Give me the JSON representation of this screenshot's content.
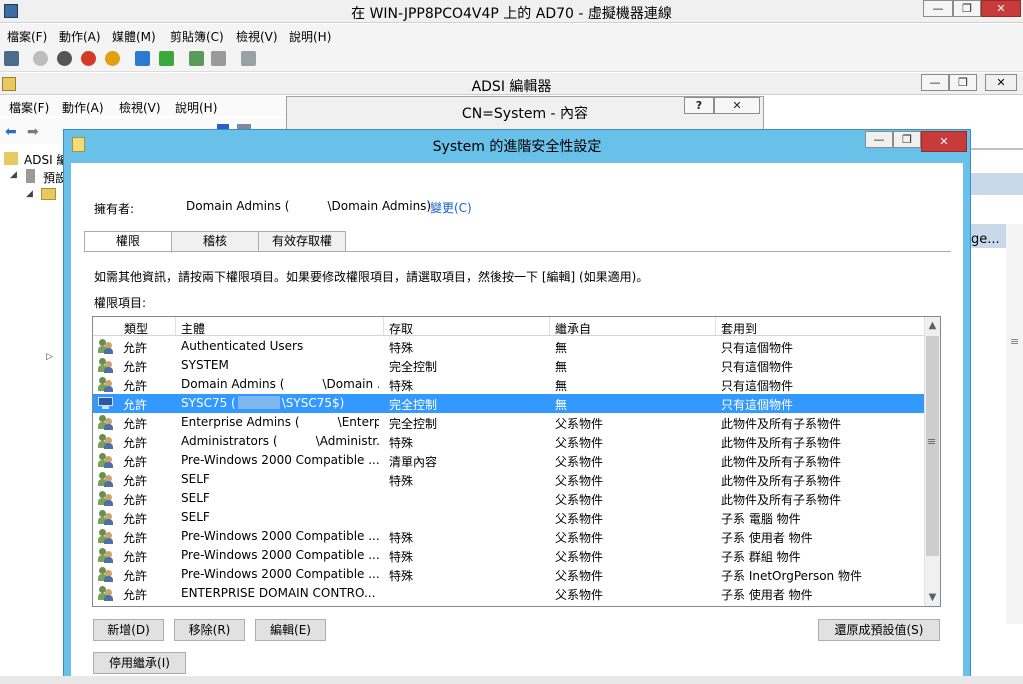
{
  "vm": {
    "title": "在 WIN-JPP8PCO4V4P 上的 AD70 - 虛擬機器連線",
    "menu": [
      "檔案(F)",
      "動作(A)",
      "媒體(M)",
      "剪貼簿(C)",
      "檢視(V)",
      "說明(H)"
    ],
    "caption_buttons": [
      "—",
      "❐",
      "✕"
    ]
  },
  "adsi": {
    "title": "ADSI 編輯器",
    "menu": [
      "檔案(F)",
      "動作(A)",
      "檢視(V)",
      "說明(H)"
    ],
    "tree_items": [
      "ADSI 編",
      "預設",
      ""
    ],
    "right_text": "ge..."
  },
  "cn": {
    "title": "CN=System - 內容",
    "help_button": "?",
    "close_button": "✕"
  },
  "dialog": {
    "title": "System 的進階安全性設定",
    "owner_label": "擁有者:",
    "owner_value": "Domain Admins (          \\Domain Admins)",
    "change_link": "變更(C)",
    "tabs": [
      "權限",
      "稽核",
      "有效存取權"
    ],
    "instructions": "如需其他資訊，請按兩下權限項目。如果要修改權限項目，請選取項目，然後按一下 [編輯] (如果適用)。",
    "entries_label": "權限項目:",
    "columns": [
      "類型",
      "主體",
      "存取",
      "繼承自",
      "套用到"
    ],
    "rows": [
      {
        "type": "允許",
        "principal": "Authenticated Users",
        "access": "特殊",
        "inherited": "無",
        "applies": "只有這個物件"
      },
      {
        "type": "允許",
        "principal": "SYSTEM",
        "access": "完全控制",
        "inherited": "無",
        "applies": "只有這個物件"
      },
      {
        "type": "允許",
        "principal": "Domain Admins (          \\Domain ...",
        "access": "特殊",
        "inherited": "無",
        "applies": "只有這個物件"
      },
      {
        "type": "允許",
        "principal_pre": "SYSC75 (",
        "principal_post": "\\SYSC75$)",
        "access": "完全控制",
        "inherited": "無",
        "applies": "只有這個物件"
      },
      {
        "type": "允許",
        "principal": "Enterprise Admins (          \\Enterp...",
        "access": "完全控制",
        "inherited": "父系物件",
        "applies": "此物件及所有子系物件"
      },
      {
        "type": "允許",
        "principal": "Administrators (          \\Administr...",
        "access": "特殊",
        "inherited": "父系物件",
        "applies": "此物件及所有子系物件"
      },
      {
        "type": "允許",
        "principal": "Pre-Windows 2000 Compatible ...",
        "access": "清單內容",
        "inherited": "父系物件",
        "applies": "此物件及所有子系物件"
      },
      {
        "type": "允許",
        "principal": "SELF",
        "access": "特殊",
        "inherited": "父系物件",
        "applies": "此物件及所有子系物件"
      },
      {
        "type": "允許",
        "principal": "SELF",
        "access": "",
        "inherited": "父系物件",
        "applies": "此物件及所有子系物件"
      },
      {
        "type": "允許",
        "principal": "SELF",
        "access": "",
        "inherited": "父系物件",
        "applies": "子系 電腦 物件"
      },
      {
        "type": "允許",
        "principal": "Pre-Windows 2000 Compatible ...",
        "access": "特殊",
        "inherited": "父系物件",
        "applies": "子系 使用者 物件"
      },
      {
        "type": "允許",
        "principal": "Pre-Windows 2000 Compatible ...",
        "access": "特殊",
        "inherited": "父系物件",
        "applies": "子系 群組 物件"
      },
      {
        "type": "允許",
        "principal": "Pre-Windows 2000 Compatible ...",
        "access": "特殊",
        "inherited": "父系物件",
        "applies": "子系 InetOrgPerson 物件"
      },
      {
        "type": "允許",
        "principal": "ENTERPRISE DOMAIN CONTRO...",
        "access": "",
        "inherited": "父系物件",
        "applies": "子系 使用者 物件"
      }
    ],
    "buttons": {
      "add": "新增(D)",
      "remove": "移除(R)",
      "edit": "編輯(E)",
      "restore": "還原成預設值(S)",
      "disable_inheritance": "停用繼承(I)"
    }
  }
}
